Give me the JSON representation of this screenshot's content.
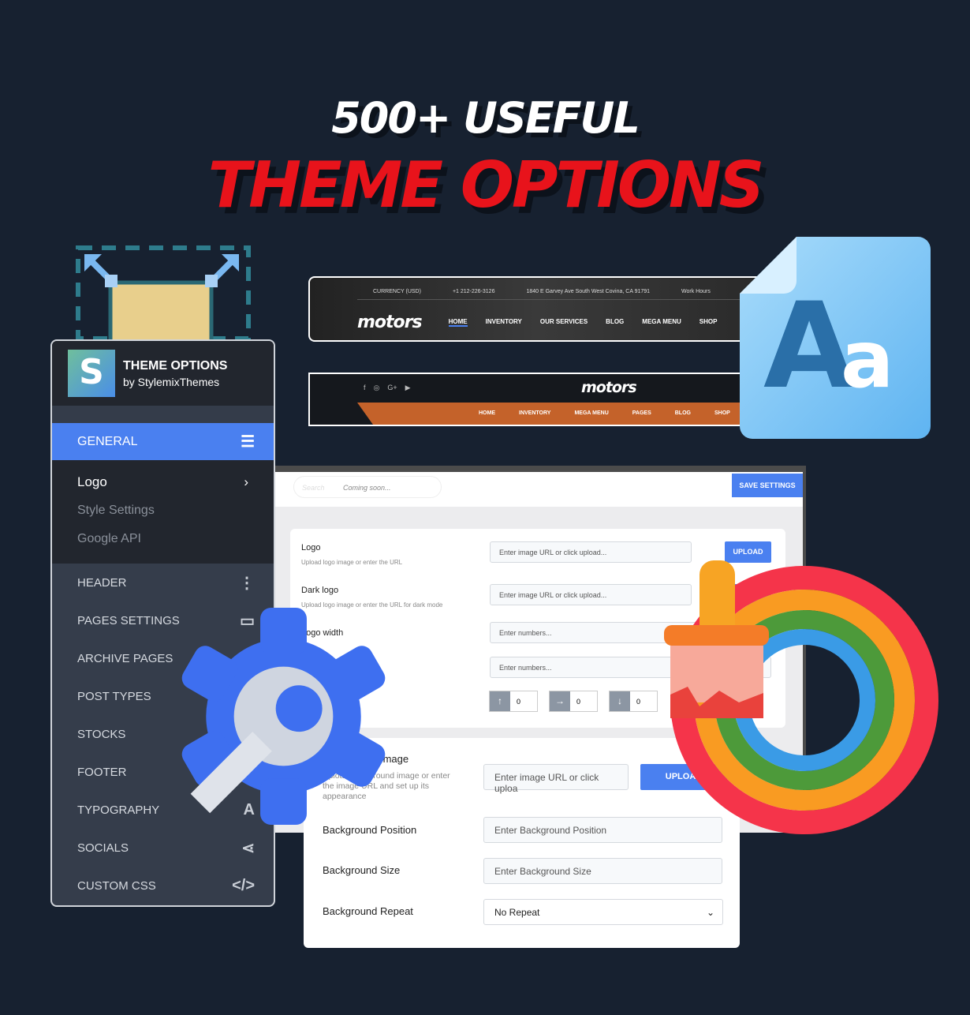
{
  "headline": {
    "line1": "500+ USEFUL",
    "line2": "THEME OPTIONS"
  },
  "header_demo_1": {
    "currency": "CURRENCY (USD)",
    "phone": "+1 212-226-3126",
    "address": "1840 E Garvey Ave South West Covina, CA 91791",
    "hours": "Work Hours",
    "logo": "motors",
    "nav": [
      "HOME",
      "INVENTORY",
      "OUR SERVICES",
      "BLOG",
      "MEGA MENU",
      "SHOP"
    ]
  },
  "header_demo_2": {
    "logo": "motors",
    "socials": [
      "f",
      "◎",
      "G+",
      "▶"
    ],
    "nav": [
      "HOME",
      "INVENTORY",
      "MEGA MENU",
      "PAGES",
      "BLOG",
      "SHOP"
    ]
  },
  "sidebar": {
    "title": "THEME OPTIONS",
    "subtitle": "by StylemixThemes",
    "logo_text": "S",
    "active": "GENERAL",
    "sub_items": [
      "Logo",
      "Style Settings",
      "Google API"
    ],
    "items": [
      {
        "label": "HEADER",
        "icon": "⋮"
      },
      {
        "label": "PAGES SETTINGS",
        "icon": "▭"
      },
      {
        "label": "ARCHIVE PAGES",
        "icon": ""
      },
      {
        "label": "POST TYPES",
        "icon": ""
      },
      {
        "label": "STOCKS",
        "icon": ""
      },
      {
        "label": "FOOTER",
        "icon": ""
      },
      {
        "label": "TYPOGRAPHY",
        "icon": "A"
      },
      {
        "label": "SOCIALS",
        "icon": "⋖"
      },
      {
        "label": "CUSTOM CSS",
        "icon": "</>"
      }
    ]
  },
  "admin": {
    "search_placeholder": "Search",
    "coming_soon": "Coming soon...",
    "save": "SAVE SETTINGS",
    "upload": "UPLOAD",
    "fields": [
      {
        "label": "Logo",
        "desc": "Upload logo image or enter the URL",
        "placeholder": "Enter image URL or click upload..."
      },
      {
        "label": "Dark logo",
        "desc": "Upload logo image or enter the URL for dark mode",
        "placeholder": "Enter image URL or click upload..."
      },
      {
        "label": "Logo width",
        "placeholder": "Enter numbers..."
      },
      {
        "placeholder": "Enter numbers..."
      }
    ],
    "spacing": [
      "0",
      "0",
      "0"
    ]
  },
  "background": {
    "label": "Background Image",
    "desc": "Upload background image or enter the image URL and set up its appearance",
    "placeholder": "Enter image URL or click uploa",
    "upload": "UPLOAD",
    "position_label": "Background Position",
    "position_placeholder": "Enter Background Position",
    "size_label": "Background Size",
    "size_placeholder": "Enter Background Size",
    "repeat_label": "Background Repeat",
    "repeat_value": "No Repeat"
  },
  "colors": {
    "accent": "#4a80f0",
    "red": "#e8131b",
    "orange": "#c4622a",
    "bg": "#172130"
  }
}
